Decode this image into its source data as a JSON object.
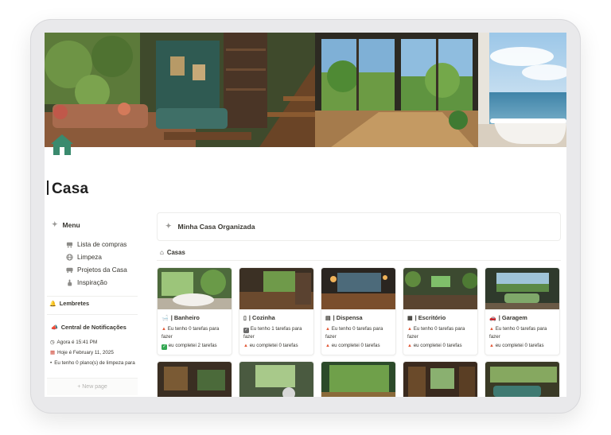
{
  "page": {
    "title": "Casa"
  },
  "menu": {
    "title": "Menu",
    "items": [
      {
        "label": "Lista de compras",
        "icon": "shopping-cart-icon"
      },
      {
        "label": "Limpeza",
        "icon": "globe-icon"
      },
      {
        "label": "Projetos da Casa",
        "icon": "bus-icon"
      },
      {
        "label": "Inspiração",
        "icon": "hand-pointer-icon"
      }
    ]
  },
  "lembretes": {
    "title": "Lembretes"
  },
  "notifications": {
    "title": "Central de Notificações",
    "now": "Agora é 15:41 PM",
    "today": "Hoje é February 11, 2025",
    "cleaning": "Eu tenho 0 plano(s) de limpeza para"
  },
  "new_page": "+ New page",
  "organizada": {
    "title": "Minha Casa Organizada"
  },
  "casas": {
    "title": "Casas",
    "cards": [
      {
        "title": "| Banheiro",
        "icon": "bathtub-icon",
        "todo": "Eu tenho 0 tarefas para fazer",
        "done": "eu completei 2 tarefas",
        "done_icon": "check"
      },
      {
        "title": "| Cozinha",
        "icon": "fridge-icon",
        "todo": "Eu tenho 1 tarefas para fazer",
        "done": "eu completei 0 tarefas",
        "todo_icon": "check-dark",
        "done_icon": "warn"
      },
      {
        "title": "| Dispensa",
        "icon": "pantry-icon",
        "todo": "Eu tenho 0 tarefas para fazer",
        "done": "eu completei 0 tarefas",
        "done_icon": "warn"
      },
      {
        "title": "| Escritório",
        "icon": "office-icon",
        "todo": "Eu tenho 0 tarefas para fazer",
        "done": "eu completei 0 tarefas",
        "done_icon": "warn"
      },
      {
        "title": "| Garagem",
        "icon": "car-icon",
        "todo": "Eu tenho 0 tarefas para fazer",
        "done": "eu completei 0 tarefas",
        "done_icon": "warn"
      }
    ]
  },
  "colors": {
    "accent_green": "#2f8a6b",
    "warn": "#e35b3a",
    "done_green": "#34a853"
  }
}
